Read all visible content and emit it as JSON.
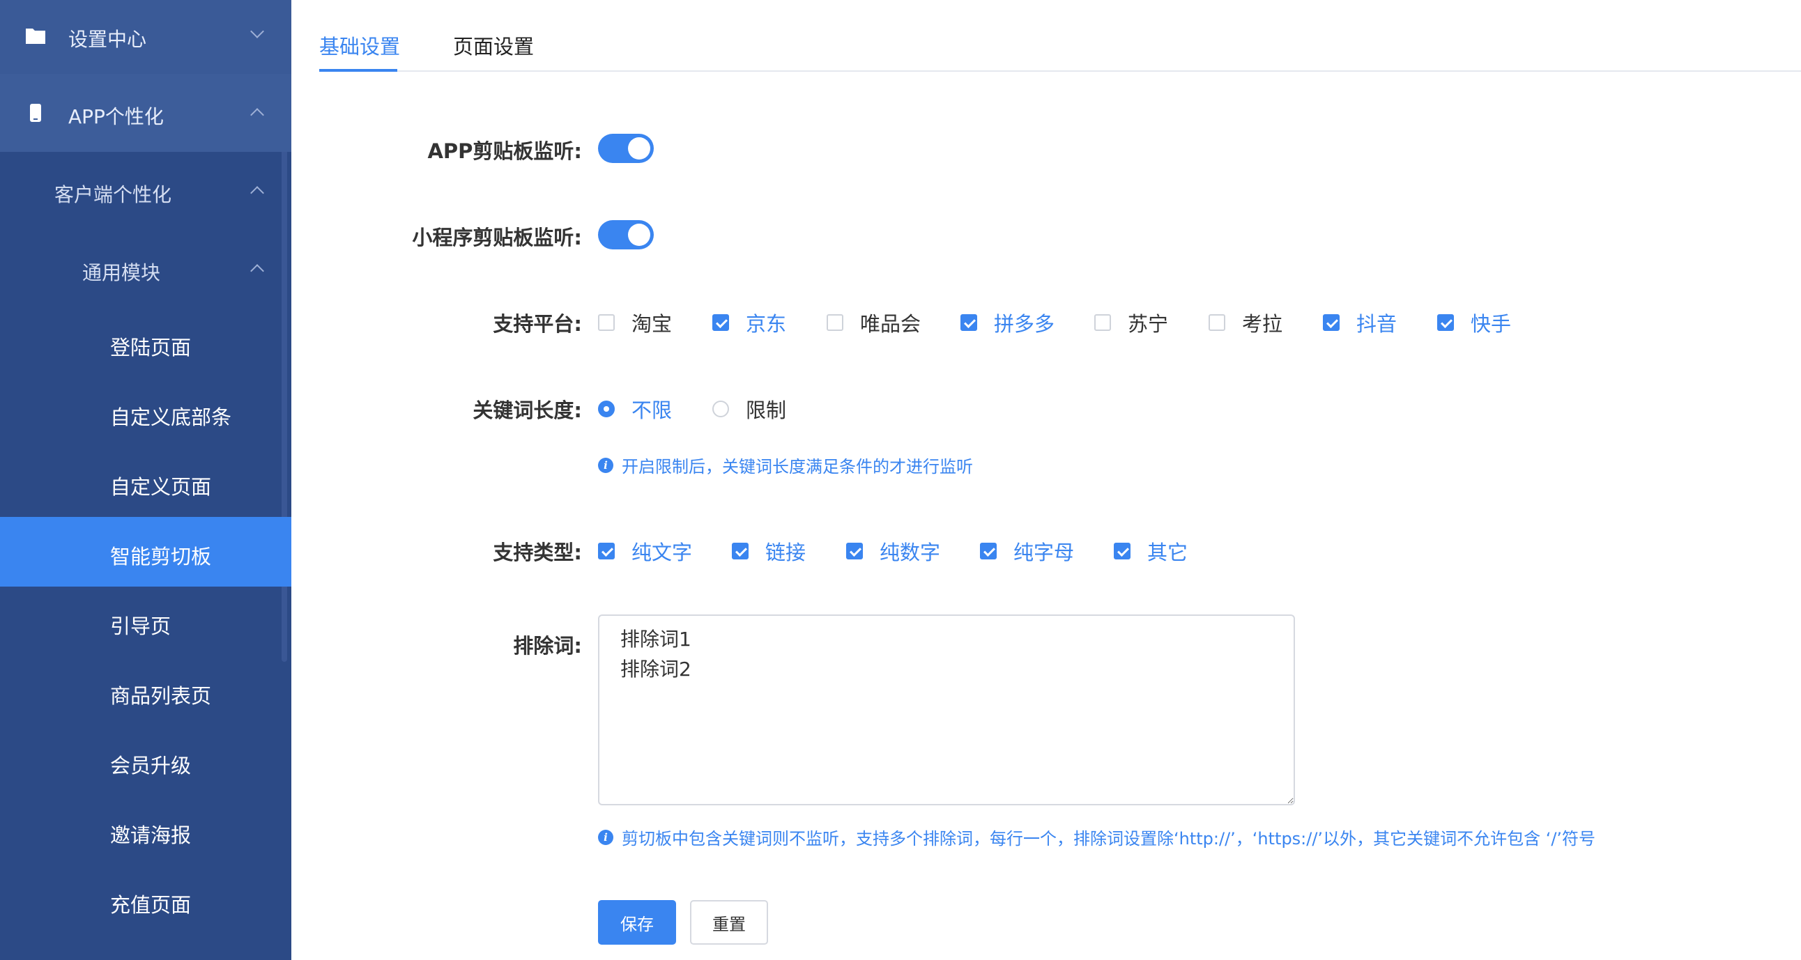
{
  "sidebar": {
    "settings_center": "设置中心",
    "app_personalize": "APP个性化",
    "client_personalize": "客户端个性化",
    "common_module": "通用模块",
    "items": [
      "登陆页面",
      "自定义底部条",
      "自定义页面",
      "智能剪切板",
      "引导页",
      "商品列表页",
      "会员升级",
      "邀请海报",
      "充值页面"
    ],
    "active_item": "智能剪切板"
  },
  "tabs": {
    "basic": "基础设置",
    "page": "页面设置",
    "active": "基础设置"
  },
  "form": {
    "app_clipboard": {
      "label": "APP剪贴板监听:",
      "enabled": true
    },
    "mini_clipboard": {
      "label": "小程序剪贴板监听:",
      "enabled": true
    },
    "platforms": {
      "label": "支持平台:",
      "options": [
        {
          "text": "淘宝",
          "checked": false
        },
        {
          "text": "京东",
          "checked": true
        },
        {
          "text": "唯品会",
          "checked": false
        },
        {
          "text": "拼多多",
          "checked": true
        },
        {
          "text": "苏宁",
          "checked": false
        },
        {
          "text": "考拉",
          "checked": false
        },
        {
          "text": "抖音",
          "checked": true
        },
        {
          "text": "快手",
          "checked": true
        }
      ]
    },
    "keyword_length": {
      "label": "关键词长度:",
      "options": [
        {
          "text": "不限",
          "selected": true
        },
        {
          "text": "限制",
          "selected": false
        }
      ],
      "hint": "开启限制后，关键词长度满足条件的才进行监听"
    },
    "types": {
      "label": "支持类型:",
      "options": [
        {
          "text": "纯文字",
          "checked": true
        },
        {
          "text": "链接",
          "checked": true
        },
        {
          "text": "纯数字",
          "checked": true
        },
        {
          "text": "纯字母",
          "checked": true
        },
        {
          "text": "其它",
          "checked": true
        }
      ]
    },
    "exclude": {
      "label": "排除词:",
      "value": "排除词1\n排除词2",
      "hint": "剪切板中包含关键词则不监听，支持多个排除词，每行一个，排除词设置除‘http://’，‘https://’以外，其它关键词不允许包含 ‘/’符号"
    },
    "save_label": "保存",
    "reset_label": "重置"
  },
  "colors": {
    "accent": "#3a85f0",
    "sidebar_bg": "#2c4a86",
    "sidebar_active": "#3a85f0"
  },
  "icons": {
    "folder": "folder-icon",
    "phone": "phone-icon",
    "info": "info-icon"
  }
}
